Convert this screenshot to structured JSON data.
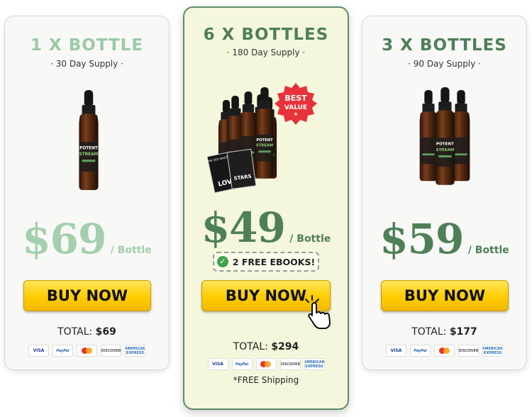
{
  "plans": {
    "left": {
      "title": "1 X BOTTLE",
      "supply": "· 30 Day Supply ·",
      "price": "$69",
      "per": "/ Bottle",
      "buy_label": "BUY NOW",
      "total_label": "TOTAL:",
      "total_value": "$69"
    },
    "center": {
      "title": "6 X BOTTLES",
      "supply": "· 180 Day Supply ·",
      "badge_line1": "BEST",
      "badge_line2": "VALUE",
      "badge_star": "★",
      "price": "$49",
      "per": "/ Bottle",
      "ebooks": "2 FREE EBOOKS!",
      "buy_label": "BUY NOW",
      "total_label": "TOTAL:",
      "total_value": "$294",
      "shipping": "*FREE Shipping"
    },
    "right": {
      "title": "3 X BOTTLES",
      "supply": "· 90 Day Supply ·",
      "price": "$59",
      "per": "/ Bottle",
      "buy_label": "BUY NOW",
      "total_label": "TOTAL:",
      "total_value": "$177"
    }
  },
  "payment_methods": [
    "VISA",
    "PayPal",
    "mastercard",
    "DISCOVER",
    "AMERICAN EXPRESS"
  ],
  "bottle_label": [
    "POTENT",
    "STREAM"
  ],
  "ebook_text": [
    "THE SEX MASTERY",
    "LOV",
    "STARS"
  ],
  "colors": {
    "accent_green": "#4f7f57",
    "faded_green": "#a3cfac",
    "button_yellow": "#ffcc00",
    "badge_red": "#e8323a",
    "featured_bg": "#f5f7dd"
  },
  "icons": [
    "check-circle-icon",
    "hand-cursor-icon",
    "visa-icon",
    "paypal-icon",
    "mastercard-icon",
    "discover-icon",
    "amex-icon"
  ]
}
